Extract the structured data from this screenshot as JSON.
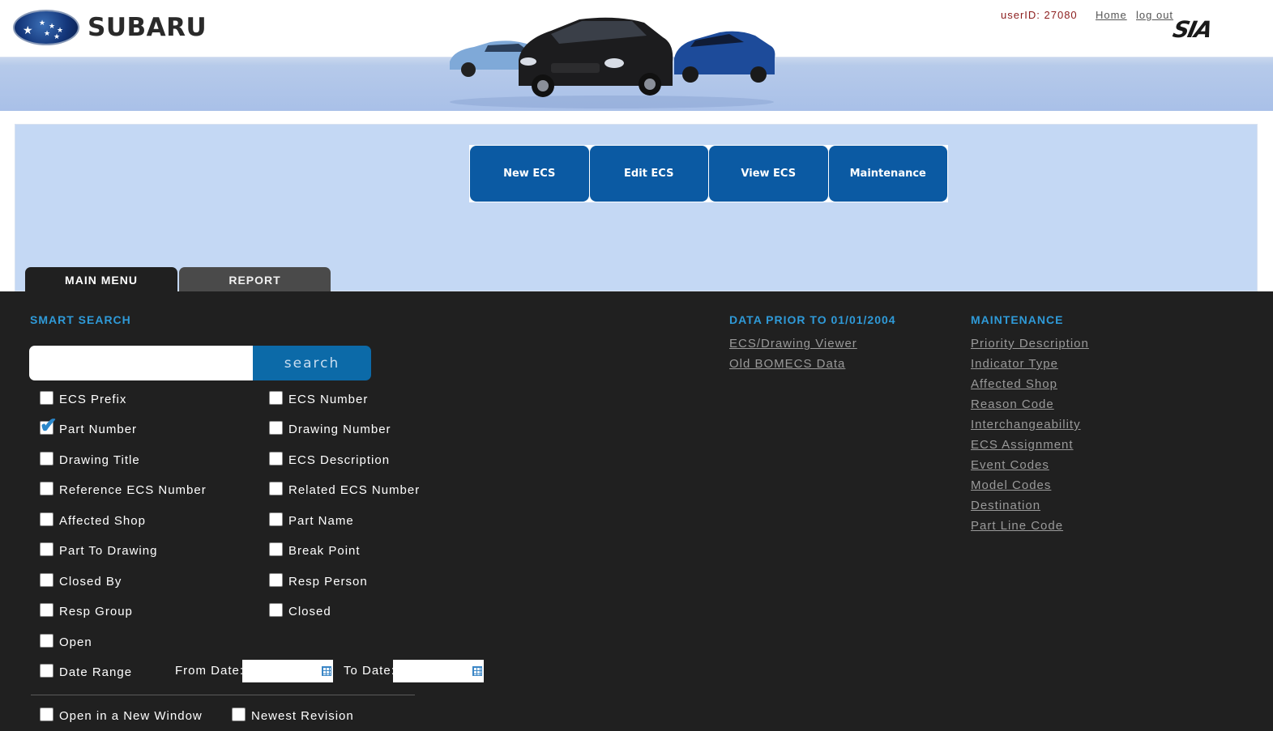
{
  "header": {
    "brand": "SUBARU",
    "user_id": "userID: 27080",
    "links": [
      "Home",
      "log out"
    ],
    "partner_logo": "SIA"
  },
  "nav": {
    "buttons": [
      "New ECS",
      "Edit ECS",
      "View ECS",
      "Maintenance"
    ],
    "tabs": [
      "MAIN MENU",
      "REPORT"
    ]
  },
  "smart_search": {
    "title": "SMART SEARCH",
    "search_value": "",
    "search_button": "search",
    "options_left": [
      {
        "label": "ECS Prefix",
        "checked": false
      },
      {
        "label": "Part Number",
        "checked": true
      },
      {
        "label": "Drawing Title",
        "checked": false
      },
      {
        "label": "Reference ECS Number",
        "checked": false
      },
      {
        "label": "Affected Shop",
        "checked": false
      },
      {
        "label": "Part To Drawing",
        "checked": false
      },
      {
        "label": "Closed By",
        "checked": false
      },
      {
        "label": "Resp Group",
        "checked": false
      },
      {
        "label": "Open",
        "checked": false
      },
      {
        "label": "Date Range",
        "checked": false
      }
    ],
    "options_right": [
      {
        "label": "ECS Number",
        "checked": false
      },
      {
        "label": "Drawing Number",
        "checked": false
      },
      {
        "label": "ECS Description",
        "checked": false
      },
      {
        "label": "Related ECS Number",
        "checked": false
      },
      {
        "label": "Part Name",
        "checked": false
      },
      {
        "label": "Break Point",
        "checked": false
      },
      {
        "label": "Resp Person",
        "checked": false
      },
      {
        "label": "Closed",
        "checked": false
      }
    ],
    "from_date_label": "From Date:",
    "to_date_label": "To Date:",
    "from_date": "",
    "to_date": "",
    "bottom_options": [
      {
        "label": "Open in a New Window",
        "checked": false
      },
      {
        "label": "Newest Revision",
        "checked": false
      }
    ]
  },
  "data_prior": {
    "title": "DATA PRIOR TO 01/01/2004",
    "links": [
      "ECS/Drawing Viewer",
      "Old BOMECS Data"
    ]
  },
  "maintenance": {
    "title": "MAINTENANCE",
    "links": [
      "Priority Description",
      "Indicator Type",
      "Affected Shop",
      "Reason Code",
      "Interchangeability",
      "ECS Assignment",
      "Event Codes",
      "Model Codes",
      "Destination",
      "Part Line Code"
    ]
  },
  "colors": {
    "nav_button": "#0b5aa3",
    "panel": "#c4d8f4",
    "dark_bg": "#202020",
    "accent_title": "#2f9ad8",
    "user_id": "#8b1c1c"
  }
}
